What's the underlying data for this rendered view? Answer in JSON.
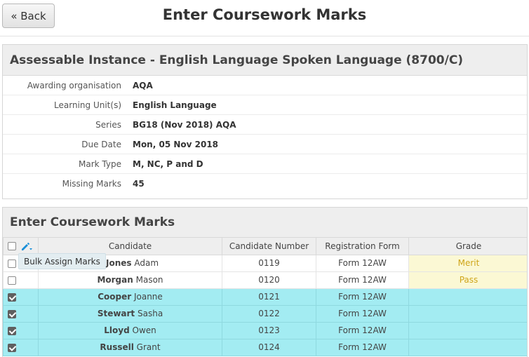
{
  "header": {
    "back_label": "« Back",
    "title": "Enter Coursework Marks"
  },
  "instance": {
    "title": "Assessable Instance - English Language Spoken Language (8700/C)",
    "rows": [
      {
        "label": "Awarding organisation",
        "value": "AQA"
      },
      {
        "label": "Learning Unit(s)",
        "value": "English Language"
      },
      {
        "label": "Series",
        "value": "BG18 (Nov 2018) AQA"
      },
      {
        "label": "Due Date",
        "value": "Mon, 05 Nov 2018"
      },
      {
        "label": "Mark Type",
        "value": "M, NC, P and D"
      },
      {
        "label": "Missing Marks",
        "value": "45"
      }
    ]
  },
  "marks": {
    "title": "Enter Coursework Marks",
    "columns": {
      "candidate": "Candidate",
      "candidate_number": "Candidate Number",
      "registration_form": "Registration Form",
      "grade": "Grade"
    },
    "tooltip": "Bulk Assign Marks",
    "rows": [
      {
        "surname": "Jones",
        "forename": "Adam",
        "number": "0119",
        "form": "Form 12AW",
        "grade": "Merit",
        "selected": false
      },
      {
        "surname": "Morgan",
        "forename": "Mason",
        "number": "0120",
        "form": "Form 12AW",
        "grade": "Pass",
        "selected": false
      },
      {
        "surname": "Cooper",
        "forename": "Joanne",
        "number": "0121",
        "form": "Form 12AW",
        "grade": "",
        "selected": true
      },
      {
        "surname": "Stewart",
        "forename": "Sasha",
        "number": "0122",
        "form": "Form 12AW",
        "grade": "",
        "selected": true
      },
      {
        "surname": "Lloyd",
        "forename": "Owen",
        "number": "0123",
        "form": "Form 12AW",
        "grade": "",
        "selected": true
      },
      {
        "surname": "Russell",
        "forename": "Grant",
        "number": "0124",
        "form": "Form 12AW",
        "grade": "",
        "selected": true
      }
    ]
  },
  "colors": {
    "selected_row": "#a3ecf2",
    "grade_cell": "#fbf8d4",
    "grade_text": "#cfa51a",
    "pencil_icon": "#1a8fd8"
  }
}
